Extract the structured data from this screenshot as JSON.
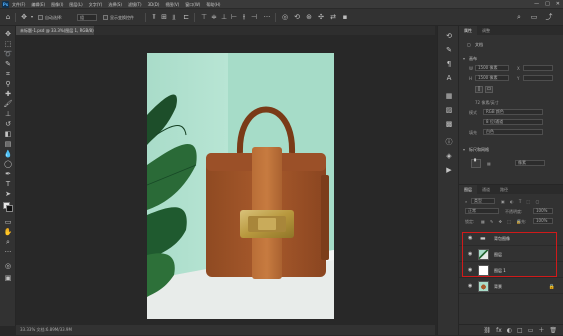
{
  "app": {
    "logo": "Ps",
    "menu": [
      "文件(F)",
      "编辑(E)",
      "图像(I)",
      "图层(L)",
      "文字(Y)",
      "选择(S)",
      "滤镜(T)",
      "3D(D)",
      "视图(V)",
      "窗口(W)",
      "帮助(H)"
    ],
    "window_controls": [
      "—",
      "□",
      "✕"
    ]
  },
  "options": {
    "auto_select_label": "自动选择:",
    "auto_select_value": "组",
    "show_transform_label": "显示变换控件"
  },
  "document": {
    "tab_title": "未标题-1.psd @ 33.3%(图层 1, RGB/8)",
    "tab_close": "×",
    "status": "33.33%    文档:6.89M/33.9M"
  },
  "properties": {
    "tabs": [
      "属性",
      "调整"
    ],
    "type_label": "文档",
    "canvas_section": "画布",
    "width_label": "W",
    "width_value": "1500 像素",
    "height_label": "H",
    "height_value": "1500 像素",
    "x_label": "X",
    "y_label": "Y",
    "resolution": "72 像素/英寸",
    "mode_label": "模式",
    "mode_value": "RGB 颜色",
    "depth_value": "8 位/通道",
    "fill_label": "填充",
    "fill_value": "白色",
    "guides_section": "标尺和网格",
    "unit_value": "像素"
  },
  "layers": {
    "tabs": [
      "图层",
      "通道",
      "路径"
    ],
    "kind_label": "类型",
    "blend_mode": "正常",
    "opacity_label": "不透明度:",
    "opacity_value": "100%",
    "lock_label": "锁定:",
    "fill_label": "填充:",
    "fill_value": "100%",
    "rows": [
      {
        "name": "背包图像",
        "type": "group"
      },
      {
        "name": "图层",
        "type": "image"
      },
      {
        "name": "图层 1",
        "type": "white"
      },
      {
        "name": "背景",
        "type": "background"
      }
    ],
    "bottom_icons": [
      "fx",
      "◐",
      "□",
      "▭",
      "＋",
      "🗑"
    ]
  },
  "colors": {
    "accent_highlight": "#d01a1a",
    "panel_bg": "#323232",
    "canvas_bg": "#282828"
  }
}
